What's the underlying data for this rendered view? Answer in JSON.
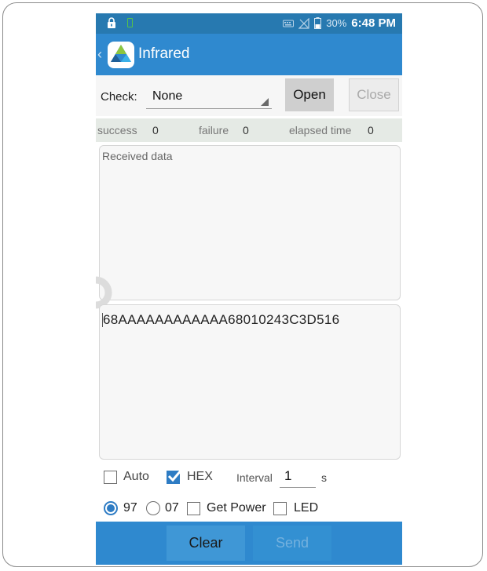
{
  "status_bar": {
    "battery_percent": "30%",
    "time": "6:48 PM",
    "icons": [
      "lock-icon",
      "battery-charging-icon",
      "keyboard-icon",
      "no-signal-icon",
      "battery-icon"
    ]
  },
  "app_bar": {
    "title": "Infrared",
    "icons": [
      "back-chevron-icon",
      "app-logo-icon"
    ]
  },
  "check": {
    "label": "Check:",
    "selected": "None",
    "open_label": "Open",
    "close_label": "Close"
  },
  "stats": {
    "success_label": "success",
    "success_value": "0",
    "failure_label": "failure",
    "failure_value": "0",
    "elapsed_label": "elapsed time",
    "elapsed_value": "0"
  },
  "received": {
    "placeholder": "Received data"
  },
  "send_input": {
    "value": "68AAAAAAAAAAAA68010243C3D516"
  },
  "options": {
    "auto_label": "Auto",
    "auto_checked": false,
    "hex_label": "HEX",
    "hex_checked": true,
    "interval_label": "Interval",
    "interval_value": "1",
    "interval_unit": "s",
    "radio_97_label": "97",
    "radio_97_selected": true,
    "radio_07_label": "07",
    "radio_07_selected": false,
    "get_power_label": "Get Power",
    "get_power_checked": false,
    "led_label": "LED",
    "led_checked": false
  },
  "bottom_bar": {
    "clear_label": "Clear",
    "send_label": "Send"
  },
  "colors": {
    "status_bar": "#2779b0",
    "app_bar": "#2f89cf",
    "accent": "#2e7cc4"
  }
}
